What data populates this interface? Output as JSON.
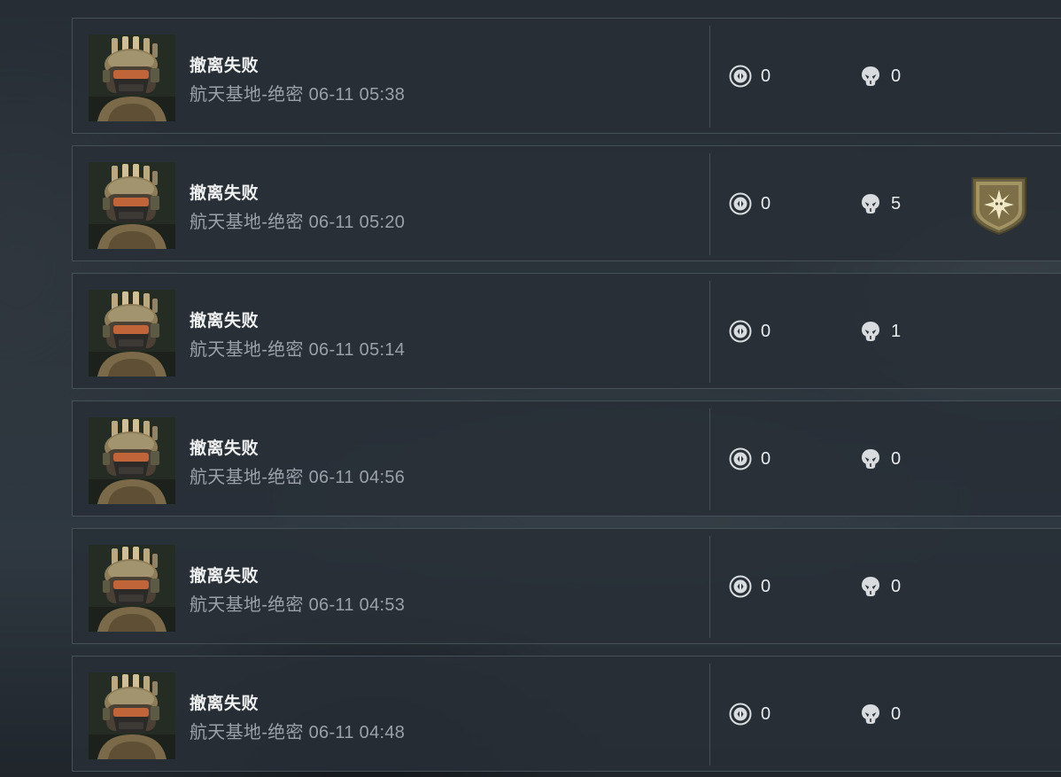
{
  "icons": {
    "portrait": "operator-portrait",
    "currency": "coin-icon",
    "kills": "skull-icon",
    "badge": "achievement-badge-icon"
  },
  "colors": {
    "background": "#2b333b",
    "card": "#2a3139",
    "card_border": "#465059",
    "title_text": "#f1f2f2",
    "subtitle_text": "#9aa1a8",
    "badge_gold": "#b59d5e"
  },
  "records": [
    {
      "result": "撤离失败",
      "map": "航天基地-绝密",
      "time": "06-11 05:38",
      "currency": "0",
      "kills": "0",
      "badge": false
    },
    {
      "result": "撤离失败",
      "map": "航天基地-绝密",
      "time": "06-11 05:20",
      "currency": "0",
      "kills": "5",
      "badge": true
    },
    {
      "result": "撤离失败",
      "map": "航天基地-绝密",
      "time": "06-11 05:14",
      "currency": "0",
      "kills": "1",
      "badge": false
    },
    {
      "result": "撤离失败",
      "map": "航天基地-绝密",
      "time": "06-11 04:56",
      "currency": "0",
      "kills": "0",
      "badge": false
    },
    {
      "result": "撤离失败",
      "map": "航天基地-绝密",
      "time": "06-11 04:53",
      "currency": "0",
      "kills": "0",
      "badge": false
    },
    {
      "result": "撤离失败",
      "map": "航天基地-绝密",
      "time": "06-11 04:48",
      "currency": "0",
      "kills": "0",
      "badge": false
    }
  ]
}
